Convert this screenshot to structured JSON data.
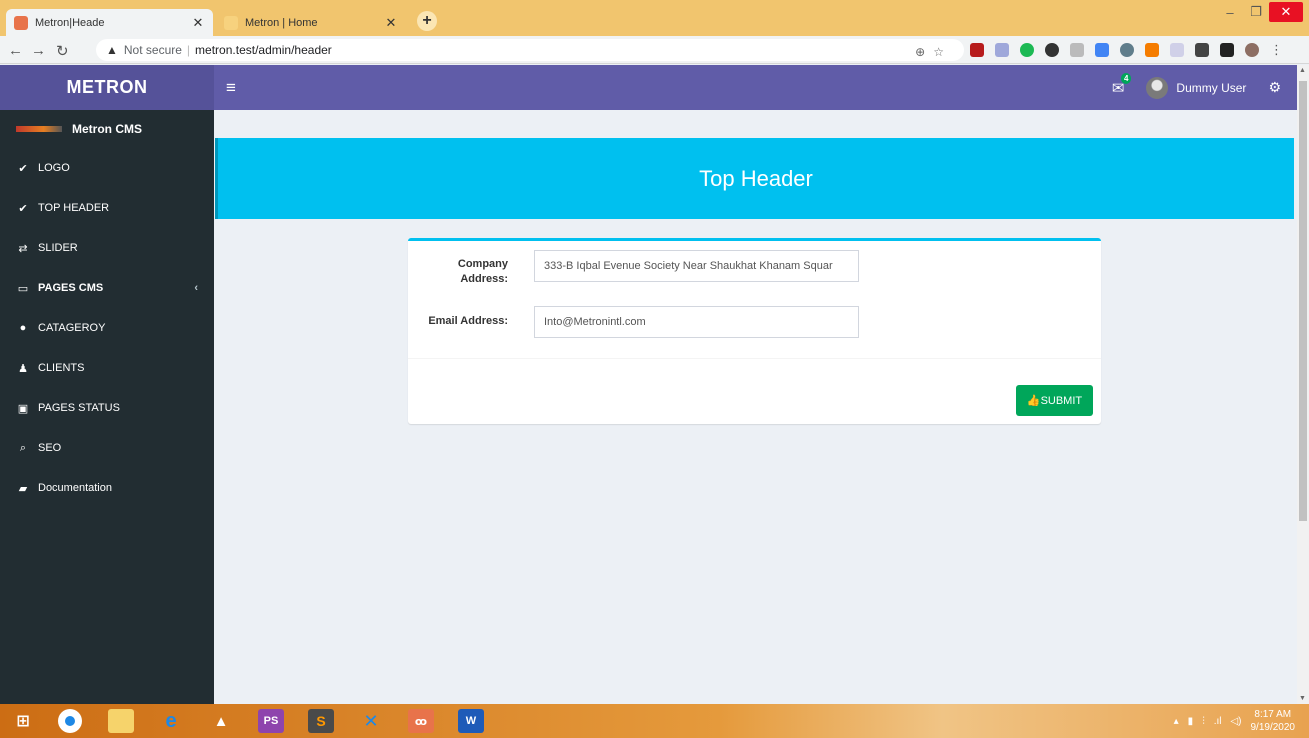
{
  "browser": {
    "tabs": [
      {
        "title": "Metron|Heade",
        "active": true
      },
      {
        "title": "Metron | Home",
        "active": false
      }
    ],
    "not_secure_label": "Not secure",
    "url": "metron.test/admin/header"
  },
  "header": {
    "logo": "METRON",
    "user_name": "Dummy User",
    "mail_badge": "4"
  },
  "sidebar": {
    "brand": "Metron CMS",
    "items": [
      {
        "label": "LOGO",
        "icon": "check-circle-icon",
        "bold": false
      },
      {
        "label": "TOP HEADER",
        "icon": "check-circle-icon",
        "bold": false
      },
      {
        "label": "SLIDER",
        "icon": "exchange-icon",
        "bold": false
      },
      {
        "label": "PAGES CMS",
        "icon": "laptop-icon",
        "bold": true,
        "expandable": true
      },
      {
        "label": "CATAGEROY",
        "icon": "circle-icon",
        "bold": false
      },
      {
        "label": "CLIENTS",
        "icon": "person-icon",
        "bold": false
      },
      {
        "label": "PAGES STATUS",
        "icon": "image-icon",
        "bold": false
      },
      {
        "label": "SEO",
        "icon": "search-icon",
        "bold": false
      },
      {
        "label": "Documentation",
        "icon": "book-icon",
        "bold": false
      }
    ]
  },
  "page": {
    "heading": "Top Header"
  },
  "form": {
    "company_address_label_line1": "Company",
    "company_address_label_line2": "Address:",
    "company_address_value": "333-B Iqbal Evenue Society Near Shaukhat Khanam Squar",
    "email_label": "Email Address:",
    "email_value": "Into@Metronintl.com",
    "submit_label": "SUBMIT"
  },
  "taskbar": {
    "time": "8:17 AM",
    "date": "9/19/2020"
  },
  "colors": {
    "header_purple": "#605ca8",
    "sidebar_dark": "#222d32",
    "hero_cyan": "#00c0ef",
    "submit_green": "#00a65a"
  }
}
